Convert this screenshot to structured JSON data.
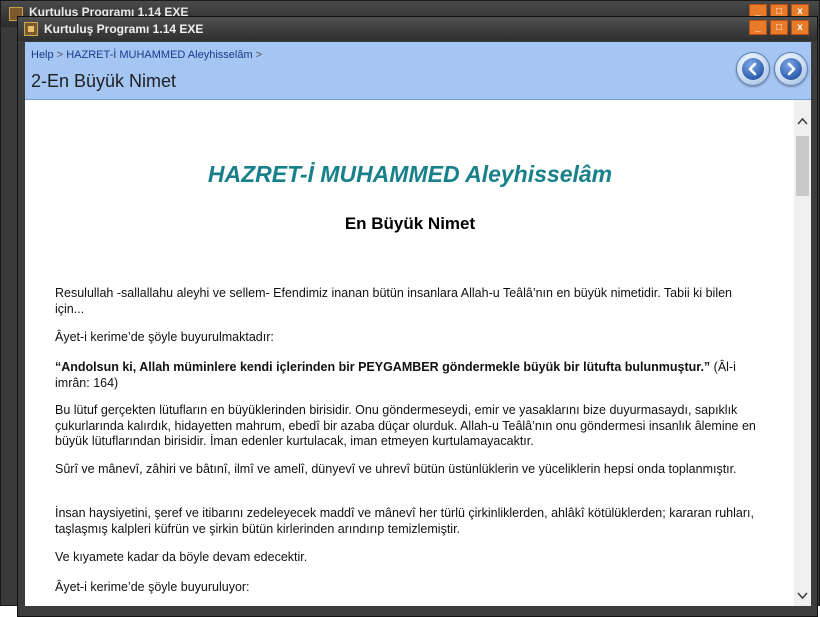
{
  "back_window": {
    "title": "Kurtuluş Programı 1.14 EXE",
    "buttons": [
      "_",
      "□",
      "x"
    ]
  },
  "window": {
    "title": "Kurtuluş Programı 1.14 EXE",
    "buttons": {
      "minimize": "_",
      "maximize": "□",
      "close": "x"
    }
  },
  "header": {
    "breadcrumb": {
      "help": "Help",
      "separator": ">",
      "section": "HAZRET-İ MUHAMMED Aleyhisselâm"
    },
    "page_title": "2-En Büyük Nimet",
    "nav": {
      "back_icon": "arrow-left-icon",
      "forward_icon": "arrow-right-icon"
    }
  },
  "content": {
    "title": "HAZRET-İ MUHAMMED Aleyhisselâm",
    "subtitle": "En Büyük Nimet",
    "p1": "Resulullah -sallallahu aleyhi ve sellem- Efendimiz inanan bütün insanlara Allah-u Teâlâ’nın en büyük nimetidir. Tabii ki bilen için...",
    "p2": "Âyet-i kerime’de şöyle buyurulmaktadır:",
    "p3_bold": "“Andolsun ki, Allah müminlere kendi içlerinden bir PEYGAMBER göndermekle büyük bir lütufta bulunmuştur.”",
    "p3_ref": " (Âl-i imrân: 164)",
    "p4": "Bu lütuf gerçekten lütufların en büyüklerinden birisidir. Onu göndermeseydi, emir ve yasaklarını bize duyurmasaydı, sapıklık çukurlarında kalırdık, hidayetten mahrum, ebedî bir azaba düçar olurduk. Allah-u Teâlâ’nın onu göndermesi insanlık âlemine en büyük lütuflarından birisidir. İman edenler kurtulacak, iman etmeyen kurtulamayacaktır.",
    "p5": "Sûrî ve mânevî, zâhiri ve bâtınî, ilmî ve amelî, dünyevî ve uhrevî bütün üstünlüklerin ve yüceliklerin hepsi onda toplanmıştır.",
    "p6": "İnsan haysiyetini, şeref ve itibarını zedeleyecek maddî ve mânevî her türlü çirkinliklerden, ahlâkî kötülüklerden; kararan ruhları, taşlaşmış kalpleri küfrün ve şirkin bütün kirlerinden arındırıp temizlemiştir.",
    "p7": "Ve kıyamete kadar da böyle devam edecektir.",
    "p8": "Âyet-i kerime’de şöyle buyuruluyor:"
  },
  "scrollbar": {
    "up_icon": "chevron-up-icon",
    "down_icon": "chevron-down-icon"
  },
  "colors": {
    "header_bg": "#a5c5f3",
    "title_teal": "#17808a",
    "window_button": "#e87a2a"
  }
}
